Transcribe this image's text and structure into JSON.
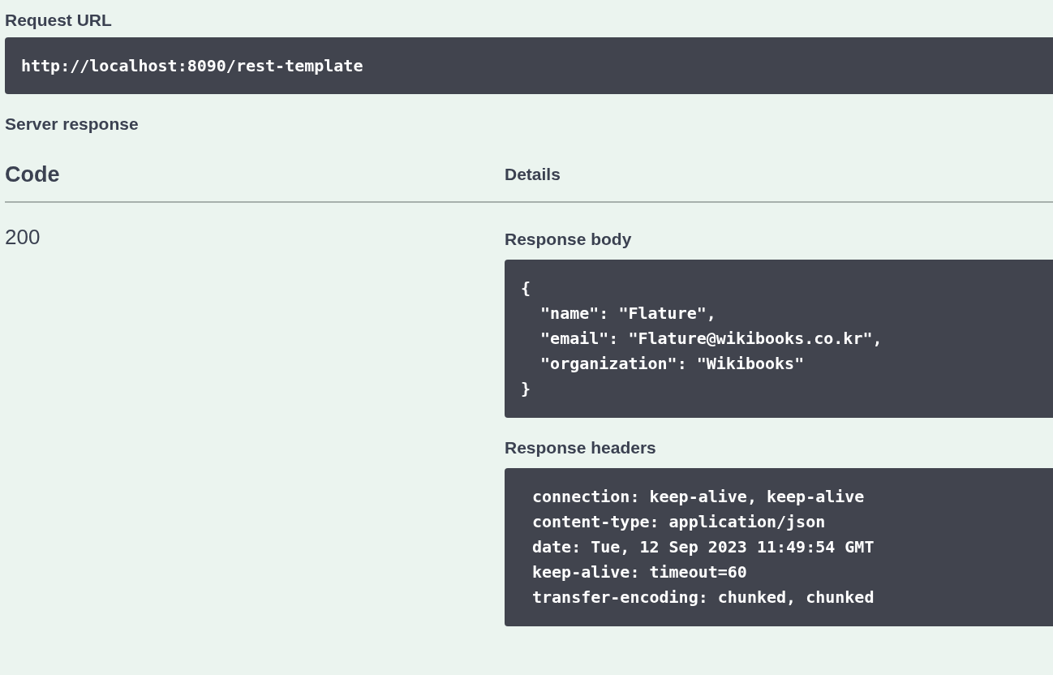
{
  "request_url": {
    "label": "Request URL",
    "value": "http://localhost:8090/rest-template"
  },
  "server_response": {
    "title": "Server response",
    "columns": [
      "Code",
      "Details"
    ],
    "rows": [
      {
        "code": "200",
        "body_label": "Response body",
        "body": [
          "{",
          "  \"name\": \"Flature\",",
          "  \"email\": \"Flature@wikibooks.co.kr\",",
          "  \"organization\": \"Wikibooks\"",
          "}"
        ],
        "headers_label": "Response headers",
        "headers": [
          "connection: keep-alive, keep-alive",
          "content-type: application/json",
          "date: Tue, 12 Sep 2023 11:49:54 GMT",
          "keep-alive: timeout=60",
          "transfer-encoding: chunked, chunked"
        ]
      }
    ]
  }
}
